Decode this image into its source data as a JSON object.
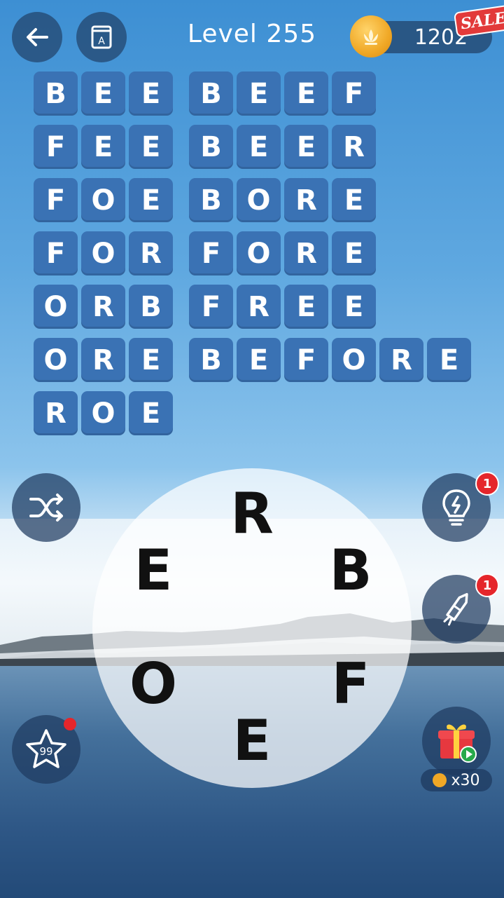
{
  "header": {
    "level_title": "Level 255",
    "coins": "1202",
    "sale_label": "SALE",
    "dict_icon_letter": "A"
  },
  "word_grid": {
    "rows": [
      {
        "left": [
          "B",
          "E",
          "E"
        ],
        "right": [
          "B",
          "E",
          "E",
          "F"
        ]
      },
      {
        "left": [
          "F",
          "E",
          "E"
        ],
        "right": [
          "B",
          "E",
          "E",
          "R"
        ]
      },
      {
        "left": [
          "F",
          "O",
          "E"
        ],
        "right": [
          "B",
          "O",
          "R",
          "E"
        ]
      },
      {
        "left": [
          "F",
          "O",
          "R"
        ],
        "right": [
          "F",
          "O",
          "R",
          "E"
        ]
      },
      {
        "left": [
          "O",
          "R",
          "B"
        ],
        "right": [
          "F",
          "R",
          "E",
          "E"
        ]
      },
      {
        "left": [
          "O",
          "R",
          "E"
        ],
        "right": [
          "B",
          "E",
          "F",
          "O",
          "R",
          "E"
        ]
      },
      {
        "left": [
          "R",
          "O",
          "E"
        ],
        "right": []
      }
    ]
  },
  "wheel": {
    "letters": [
      "R",
      "B",
      "F",
      "E",
      "O",
      "E"
    ]
  },
  "side_buttons": {
    "hint_badge": "1",
    "rocket_badge": "1",
    "star_level": "99",
    "gift_reward": "x30"
  },
  "colors": {
    "tile": "#3a72b4",
    "badge": "#e5262b",
    "coin": "#f0a826"
  }
}
